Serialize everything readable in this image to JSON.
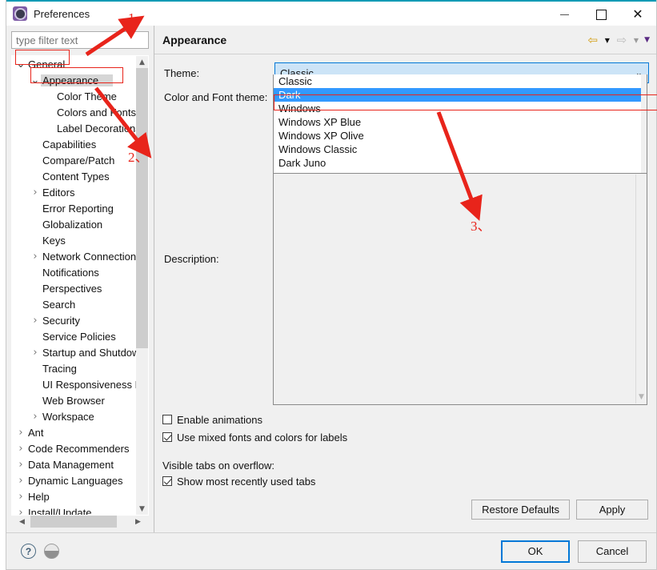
{
  "window": {
    "title": "Preferences",
    "icon": "preferences-gear-icon",
    "controls": {
      "minimize": "minimize-icon",
      "maximize": "maximize-icon",
      "close": "close-icon"
    }
  },
  "sidebar": {
    "filter": {
      "placeholder": "type filter text",
      "value": ""
    },
    "items": [
      {
        "label": "General",
        "depth": 0,
        "twisty": "expanded",
        "selected": false
      },
      {
        "label": "Appearance",
        "depth": 1,
        "twisty": "expanded",
        "selected": true
      },
      {
        "label": "Color Theme",
        "depth": 2,
        "twisty": "none",
        "selected": false
      },
      {
        "label": "Colors and Fonts",
        "depth": 2,
        "twisty": "none",
        "selected": false
      },
      {
        "label": "Label Decorations",
        "depth": 2,
        "twisty": "none",
        "selected": false
      },
      {
        "label": "Capabilities",
        "depth": 1,
        "twisty": "none",
        "selected": false
      },
      {
        "label": "Compare/Patch",
        "depth": 1,
        "twisty": "none",
        "selected": false
      },
      {
        "label": "Content Types",
        "depth": 1,
        "twisty": "none",
        "selected": false
      },
      {
        "label": "Editors",
        "depth": 1,
        "twisty": "collapsed",
        "selected": false
      },
      {
        "label": "Error Reporting",
        "depth": 1,
        "twisty": "none",
        "selected": false
      },
      {
        "label": "Globalization",
        "depth": 1,
        "twisty": "none",
        "selected": false
      },
      {
        "label": "Keys",
        "depth": 1,
        "twisty": "none",
        "selected": false
      },
      {
        "label": "Network Connections",
        "depth": 1,
        "twisty": "collapsed",
        "selected": false
      },
      {
        "label": "Notifications",
        "depth": 1,
        "twisty": "none",
        "selected": false
      },
      {
        "label": "Perspectives",
        "depth": 1,
        "twisty": "none",
        "selected": false
      },
      {
        "label": "Search",
        "depth": 1,
        "twisty": "none",
        "selected": false
      },
      {
        "label": "Security",
        "depth": 1,
        "twisty": "collapsed",
        "selected": false
      },
      {
        "label": "Service Policies",
        "depth": 1,
        "twisty": "none",
        "selected": false
      },
      {
        "label": "Startup and Shutdown",
        "depth": 1,
        "twisty": "collapsed",
        "selected": false
      },
      {
        "label": "Tracing",
        "depth": 1,
        "twisty": "none",
        "selected": false
      },
      {
        "label": "UI Responsiveness Monitoring",
        "depth": 1,
        "twisty": "none",
        "selected": false
      },
      {
        "label": "Web Browser",
        "depth": 1,
        "twisty": "none",
        "selected": false
      },
      {
        "label": "Workspace",
        "depth": 1,
        "twisty": "collapsed",
        "selected": false
      },
      {
        "label": "Ant",
        "depth": 0,
        "twisty": "collapsed",
        "selected": false
      },
      {
        "label": "Code Recommenders",
        "depth": 0,
        "twisty": "collapsed",
        "selected": false
      },
      {
        "label": "Data Management",
        "depth": 0,
        "twisty": "collapsed",
        "selected": false
      },
      {
        "label": "Dynamic Languages",
        "depth": 0,
        "twisty": "collapsed",
        "selected": false
      },
      {
        "label": "Help",
        "depth": 0,
        "twisty": "collapsed",
        "selected": false
      },
      {
        "label": "Install/Update",
        "depth": 0,
        "twisty": "collapsed",
        "selected": false
      }
    ]
  },
  "page": {
    "title": "Appearance",
    "nav": {
      "back_icon": "back-arrow-icon",
      "back_menu_icon": "chevron-down-icon",
      "forward_icon": "forward-arrow-icon",
      "forward_menu_icon": "chevron-down-icon",
      "view_menu_icon": "chevron-down-icon"
    },
    "theme": {
      "label": "Theme:",
      "value": "Classic",
      "chevron": "chevron-down-icon",
      "options": [
        {
          "label": "Classic",
          "selected": false
        },
        {
          "label": "Dark",
          "selected": true
        },
        {
          "label": "Windows",
          "selected": false
        },
        {
          "label": "Windows XP Blue",
          "selected": false
        },
        {
          "label": "Windows XP Olive",
          "selected": false
        },
        {
          "label": "Windows Classic",
          "selected": false
        },
        {
          "label": "Dark Juno",
          "selected": false
        }
      ]
    },
    "color_font_theme": {
      "label": "Color and Font theme:",
      "value": ""
    },
    "description": {
      "label": "Description:",
      "value": ""
    },
    "checkboxes": [
      {
        "label": "Enable animations",
        "checked": false
      },
      {
        "label": "Use mixed fonts and colors for labels",
        "checked": true
      }
    ],
    "overflow": {
      "label": "Visible tabs on overflow:",
      "checkbox": {
        "label": "Show most recently used tabs",
        "checked": true
      }
    },
    "buttons": {
      "restore_defaults": "Restore Defaults",
      "apply": "Apply"
    }
  },
  "footer": {
    "help_icon": "help-icon",
    "extra_icon": "status-circle-icon",
    "ok": "OK",
    "cancel": "Cancel"
  },
  "annotations": [
    {
      "label": "1、"
    },
    {
      "label": "2、"
    },
    {
      "label": "3、"
    }
  ],
  "colors": {
    "accent": "#0078d7",
    "combo_bg": "#cce4f7",
    "selection": "#3399ff",
    "annotation": "#e8241b",
    "titlebar_accent": "#0a9bb5"
  }
}
